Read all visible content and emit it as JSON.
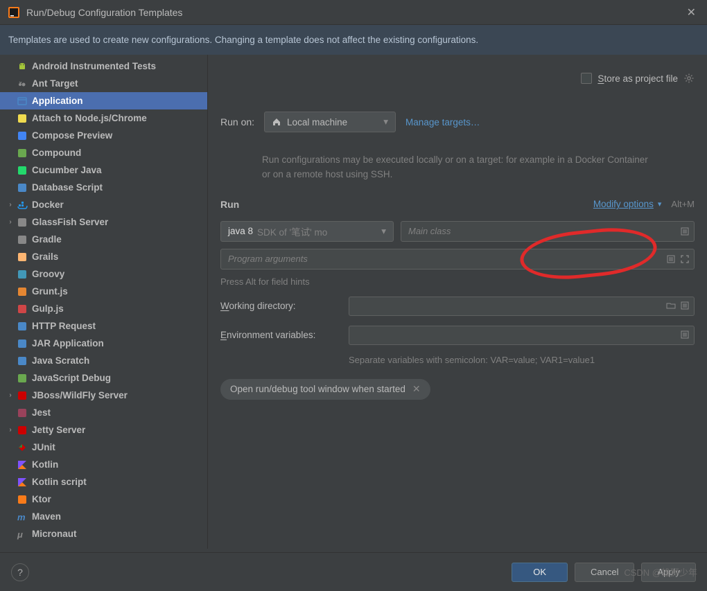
{
  "titlebar": {
    "title": "Run/Debug Configuration Templates"
  },
  "infobar": "Templates are used to create new configurations. Changing a template does not affect the existing configurations.",
  "sidebar": {
    "items": [
      {
        "label": "Android Instrumented Tests",
        "icon": "android",
        "expandable": false
      },
      {
        "label": "Ant Target",
        "icon": "ant",
        "expandable": false
      },
      {
        "label": "Application",
        "icon": "app",
        "selected": true
      },
      {
        "label": "Attach to Node.js/Chrome",
        "icon": "js",
        "expandable": false
      },
      {
        "label": "Compose Preview",
        "icon": "compose",
        "expandable": false
      },
      {
        "label": "Compound",
        "icon": "compound",
        "expandable": false
      },
      {
        "label": "Cucumber Java",
        "icon": "cucumber",
        "expandable": false
      },
      {
        "label": "Database Script",
        "icon": "db",
        "expandable": false
      },
      {
        "label": "Docker",
        "icon": "docker",
        "expandable": true
      },
      {
        "label": "GlassFish Server",
        "icon": "glassfish",
        "expandable": true
      },
      {
        "label": "Gradle",
        "icon": "gradle",
        "expandable": false
      },
      {
        "label": "Grails",
        "icon": "grails",
        "expandable": false
      },
      {
        "label": "Groovy",
        "icon": "groovy",
        "expandable": false
      },
      {
        "label": "Grunt.js",
        "icon": "grunt",
        "expandable": false
      },
      {
        "label": "Gulp.js",
        "icon": "gulp",
        "expandable": false
      },
      {
        "label": "HTTP Request",
        "icon": "http",
        "expandable": false
      },
      {
        "label": "JAR Application",
        "icon": "jar",
        "expandable": false
      },
      {
        "label": "Java Scratch",
        "icon": "scratch",
        "expandable": false
      },
      {
        "label": "JavaScript Debug",
        "icon": "jsdebug",
        "expandable": false
      },
      {
        "label": "JBoss/WildFly Server",
        "icon": "jboss",
        "expandable": true
      },
      {
        "label": "Jest",
        "icon": "jest",
        "expandable": false
      },
      {
        "label": "Jetty Server",
        "icon": "jetty",
        "expandable": true
      },
      {
        "label": "JUnit",
        "icon": "junit",
        "expandable": false
      },
      {
        "label": "Kotlin",
        "icon": "kotlin",
        "expandable": false
      },
      {
        "label": "Kotlin script",
        "icon": "kotlin",
        "expandable": false
      },
      {
        "label": "Ktor",
        "icon": "ktor",
        "expandable": false
      },
      {
        "label": "Maven",
        "icon": "maven",
        "expandable": false
      },
      {
        "label": "Micronaut",
        "icon": "micronaut",
        "expandable": false
      }
    ]
  },
  "main": {
    "storeLabel": "Store as project file",
    "runOnLabel": "Run on:",
    "runOnValue": "Local machine",
    "manageTargets": "Manage targets…",
    "description": "Run configurations may be executed locally or on a target: for example in a Docker Container or on a remote host using SSH.",
    "runSection": "Run",
    "modifyOptions": "Modify options",
    "modifyShortcut": "Alt+M",
    "javaVersion": "java 8",
    "sdkText": "SDK of '笔试' mo",
    "mainClassPlaceholder": "Main class",
    "programArgsPlaceholder": "Program arguments",
    "fieldHints": "Press Alt for field hints",
    "workingDir": "Working directory:",
    "envVars": "Environment variables:",
    "envHint": "Separate variables with semicolon: VAR=value; VAR1=value1",
    "chip": "Open run/debug tool window when started"
  },
  "footer": {
    "ok": "OK",
    "cancel": "Cancel",
    "apply": "Apply"
  },
  "watermark": "CSDN @雄狮少年"
}
